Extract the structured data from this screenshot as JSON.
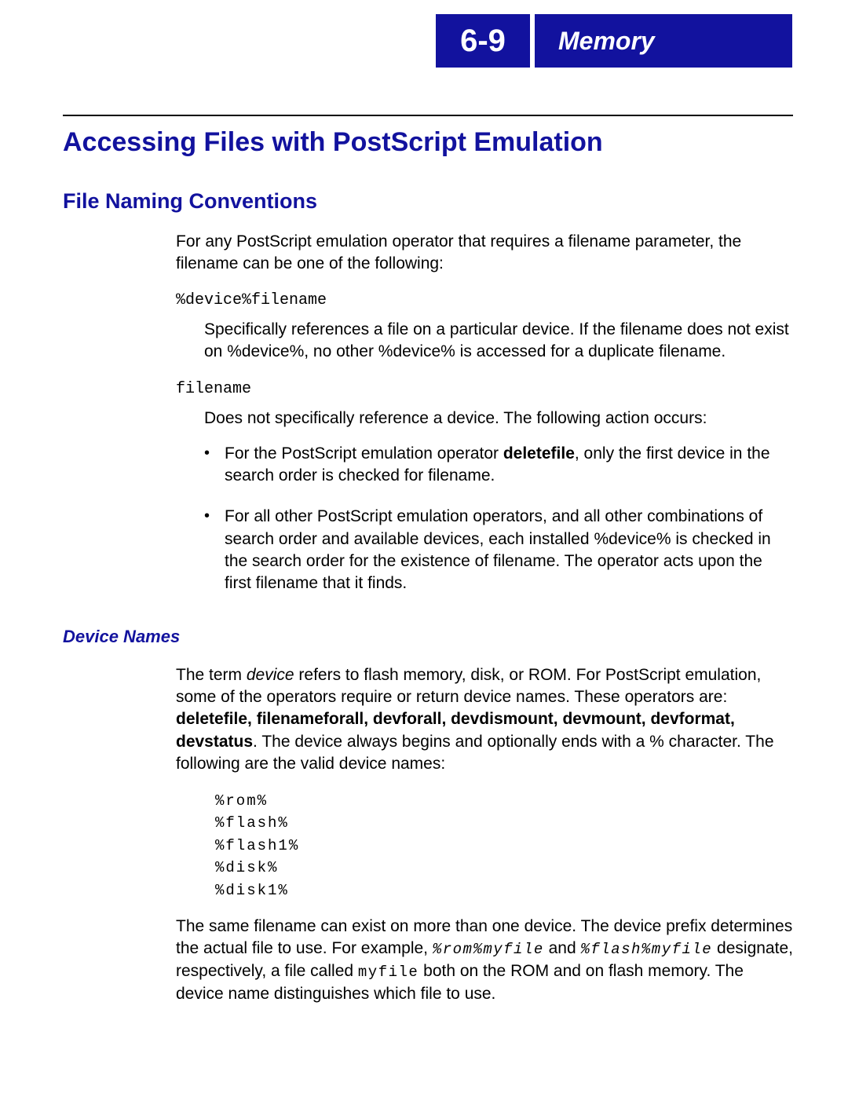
{
  "header": {
    "page_ref": "6-9",
    "chapter": "Memory"
  },
  "title": "Accessing Files with PostScript Emulation",
  "section1": {
    "heading": "File Naming Conventions",
    "intro": "For any PostScript emulation operator that requires a filename parameter, the filename can be one of the following:",
    "term1": "%device%filename",
    "desc1": "Specifically references a file on a particular device. If the filename does not exist on %device%, no other %device% is accessed for a duplicate filename.",
    "term2": "filename",
    "desc2": "Does not specifically reference a device. The following action occurs:",
    "bullet1_a": "For the PostScript emulation operator ",
    "bullet1_bold": "deletefile",
    "bullet1_b": ", only the first device in the search order is checked for filename.",
    "bullet2": "For all other PostScript emulation operators, and all other combinations of search order and available devices, each installed %device% is checked in the search order for the existence of filename. The operator acts upon the first filename that it finds."
  },
  "section2": {
    "heading": "Device Names",
    "p1_a": "The term ",
    "p1_ital": "device",
    "p1_b": " refers to flash memory, disk, or ROM. For PostScript emulation, some of the operators require or return device names. These operators are: ",
    "p1_bold": "deletefile, filenameforall, devforall, devdismount, devmount, devformat, devstatus",
    "p1_c": ". The device always begins and optionally ends with a % character. The following are the valid device names:",
    "devices_block": "%rom%\n%flash%\n%flash1%\n%disk%\n%disk1%",
    "p2_a": "The same filename can exist on more than one device. The device prefix determines the actual file to use. For example, ",
    "p2_code1": "%rom%myfile",
    "p2_mid1": " and ",
    "p2_code2": "%flash%myfile",
    "p2_mid2": " designate, respectively, a file called ",
    "p2_code3": "myfile",
    "p2_b": " both on the ROM and on flash memory. The device name distinguishes which file to use."
  }
}
